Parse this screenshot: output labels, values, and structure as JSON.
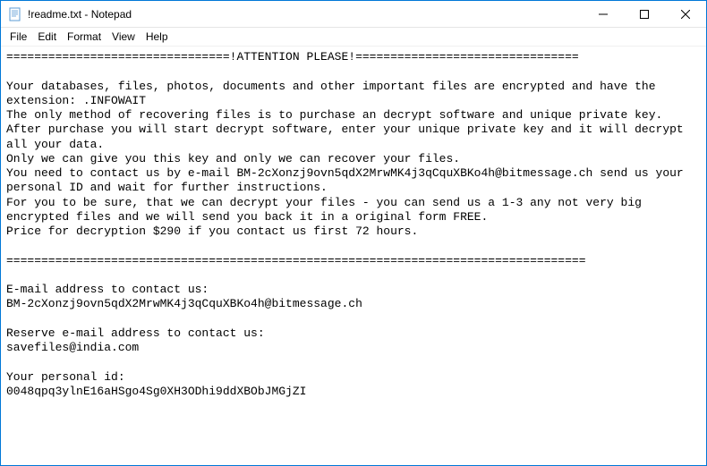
{
  "window": {
    "title": "!readme.txt - Notepad"
  },
  "menu": {
    "file": "File",
    "edit": "Edit",
    "format": "Format",
    "view": "View",
    "help": "Help"
  },
  "document": {
    "text": "================================!ATTENTION PLEASE!================================\n\nYour databases, files, photos, documents and other important files are encrypted and have the extension: .INFOWAIT\nThe only method of recovering files is to purchase an decrypt software and unique private key.\nAfter purchase you will start decrypt software, enter your unique private key and it will decrypt all your data.\nOnly we can give you this key and only we can recover your files.\nYou need to contact us by e-mail BM-2cXonzj9ovn5qdX2MrwMK4j3qCquXBKo4h@bitmessage.ch send us your personal ID and wait for further instructions.\nFor you to be sure, that we can decrypt your files - you can send us a 1-3 any not very big encrypted files and we will send you back it in a original form FREE.\nPrice for decryption $290 if you contact us first 72 hours.\n\n===================================================================================\n\nE-mail address to contact us:\nBM-2cXonzj9ovn5qdX2MrwMK4j3qCquXBKo4h@bitmessage.ch\n\nReserve e-mail address to contact us:\nsavefiles@india.com\n\nYour personal id:\n0048qpq3ylnE16aHSgo4Sg0XH3ODhi9ddXBObJMGjZI"
  }
}
